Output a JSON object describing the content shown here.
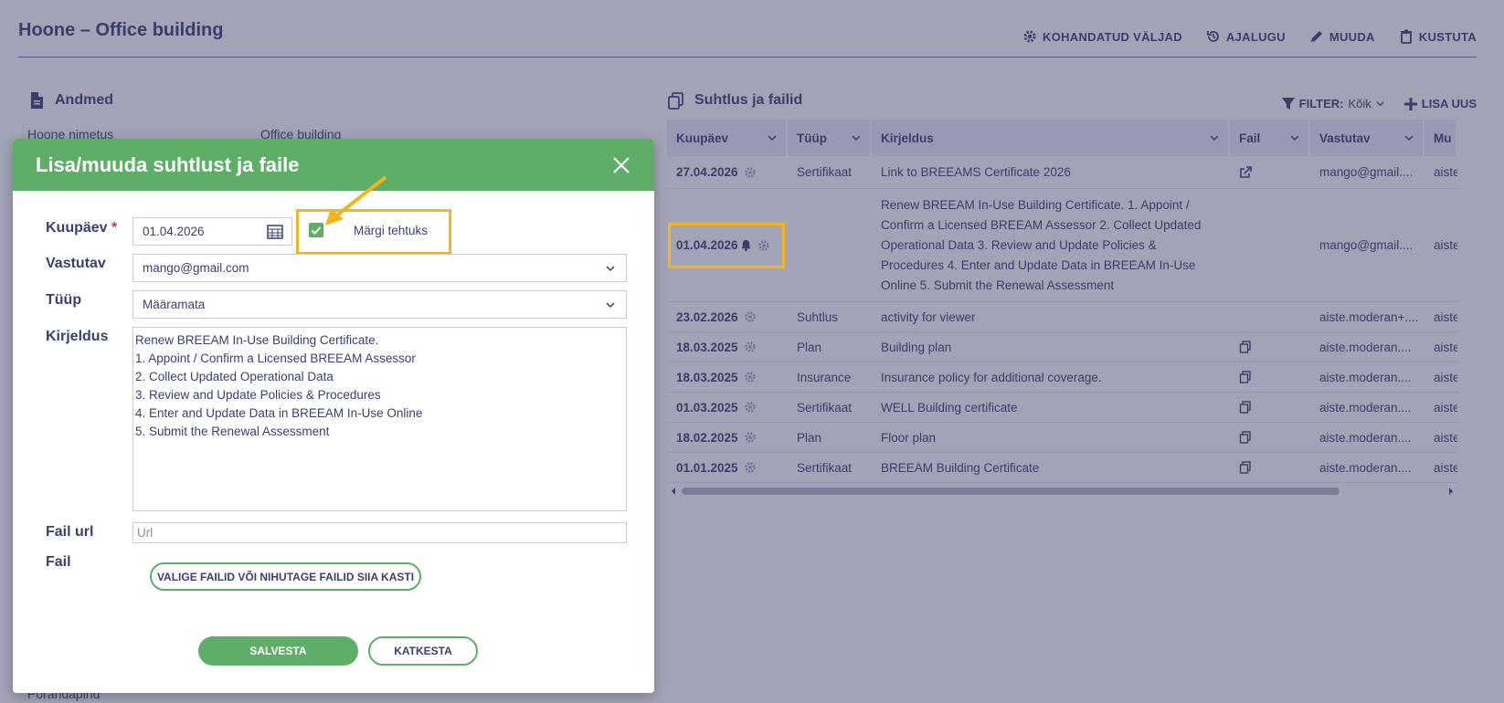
{
  "page": {
    "title": "Hoone – Office building",
    "actions": [
      {
        "label": "KOHANDATUD VÄLJAD",
        "icon": "gear-icon"
      },
      {
        "label": "AJALUGU",
        "icon": "history-icon"
      },
      {
        "label": "MUUDA",
        "icon": "pencil-icon"
      },
      {
        "label": "KUSTUTA",
        "icon": "trash-icon"
      }
    ]
  },
  "andmed": {
    "title": "Andmed",
    "rows": [
      {
        "label": "Hoone nimetus",
        "value": "Office building"
      }
    ],
    "bottom_label": "Põrandapind"
  },
  "suhtlus": {
    "title": "Suhtlus ja failid",
    "filter_label": "FILTER:",
    "filter_value": "Kõik",
    "add_label": "LISA UUS",
    "columns": [
      "Kuupäev",
      "Tüüp",
      "Kirjeldus",
      "Fail",
      "Vastutav",
      "Mu"
    ],
    "rows": [
      {
        "date": "27.04.2026",
        "type": "Sertifikaat",
        "desc": "Link to BREEAMS Certificate 2026",
        "file": "external",
        "owner": "mango@gmail....",
        "extra": "aiste"
      },
      {
        "date": "01.04.2026",
        "type": "",
        "desc": "Renew BREEAM In-Use Building Certificate. 1. Appoint / Confirm a Licensed BREEAM Assessor 2. Collect Updated Operational Data 3. Review and Update Policies & Procedures 4. Enter and Update Data in BREEAM In-Use Online 5. Submit the Renewal Assessment",
        "file": "",
        "owner": "mango@gmail....",
        "extra": "aiste",
        "bell": true
      },
      {
        "date": "23.02.2026",
        "type": "Suhtlus",
        "desc": "activity for viewer",
        "file": "",
        "owner": "aiste.moderan+....",
        "extra": "aiste"
      },
      {
        "date": "18.03.2025",
        "type": "Plan",
        "desc": "Building plan",
        "file": "copy",
        "owner": "aiste.moderan....",
        "extra": "aiste"
      },
      {
        "date": "18.03.2025",
        "type": "Insurance",
        "desc": "Insurance policy for additional coverage.",
        "file": "copy",
        "owner": "aiste.moderan....",
        "extra": "aiste"
      },
      {
        "date": "01.03.2025",
        "type": "Sertifikaat",
        "desc": "WELL Building certificate",
        "file": "copy",
        "owner": "aiste.moderan....",
        "extra": "aiste"
      },
      {
        "date": "18.02.2025",
        "type": "Plan",
        "desc": "Floor plan",
        "file": "copy",
        "owner": "aiste.moderan....",
        "extra": "aiste"
      },
      {
        "date": "01.01.2025",
        "type": "Sertifikaat",
        "desc": "BREEAM Building Certificate",
        "file": "copy",
        "owner": "aiste.moderan....",
        "extra": "aiste"
      }
    ]
  },
  "modal": {
    "title": "Lisa/muuda suhtlust ja faile",
    "date_label": "Kuupäev",
    "date_value": "01.04.2026",
    "done_label": "Märgi tehtuks",
    "done_checked": true,
    "owner_label": "Vastutav",
    "owner_value": "mango@gmail.com",
    "type_label": "Tüüp",
    "type_value": "Määramata",
    "desc_label": "Kirjeldus",
    "desc_value": "Renew BREEAM In-Use Building Certificate.\n1. Appoint / Confirm a Licensed BREEAM Assessor\n2. Collect Updated Operational Data\n3. Review and Update Policies & Procedures\n4. Enter and Update Data in BREEAM In-Use Online\n5. Submit the Renewal Assessment",
    "url_label": "Fail url",
    "url_placeholder": "Url",
    "file_label": "Fail",
    "file_button": "VALIGE FAILID VÕI NIHUTAGE FAILID SIIA KASTI",
    "save_button": "SALVESTA",
    "cancel_button": "KATKESTA"
  },
  "colors": {
    "accent": "#5fae68",
    "highlight": "#f2b51e",
    "text": "#3b3f70"
  }
}
